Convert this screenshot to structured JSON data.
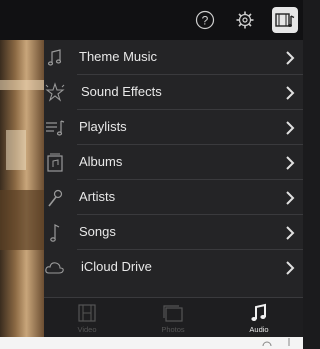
{
  "header": {
    "help_icon": "question-circle-icon",
    "settings_icon": "gear-icon",
    "media_icon": "film-music-icon"
  },
  "audio_menu": {
    "items": [
      {
        "label": "Theme Music",
        "icon": "music-note-icon"
      },
      {
        "label": "Sound Effects",
        "icon": "sparkle-star-icon"
      },
      {
        "label": "Playlists",
        "icon": "playlist-icon"
      },
      {
        "label": "Albums",
        "icon": "album-icon"
      },
      {
        "label": "Artists",
        "icon": "microphone-icon"
      },
      {
        "label": "Songs",
        "icon": "single-note-icon"
      },
      {
        "label": "iCloud Drive",
        "icon": "cloud-icon"
      }
    ],
    "chevron_icon": "chevron-right-icon"
  },
  "tabs": [
    {
      "label": "Video",
      "icon": "film-strip-icon",
      "active": false
    },
    {
      "label": "Photos",
      "icon": "photos-icon",
      "active": false
    },
    {
      "label": "Audio",
      "icon": "music-note-icon",
      "active": true
    }
  ],
  "colors": {
    "background": "#1b1b1d",
    "panel": "#242426",
    "text": "#e8e8e8",
    "inactive": "#555555"
  }
}
